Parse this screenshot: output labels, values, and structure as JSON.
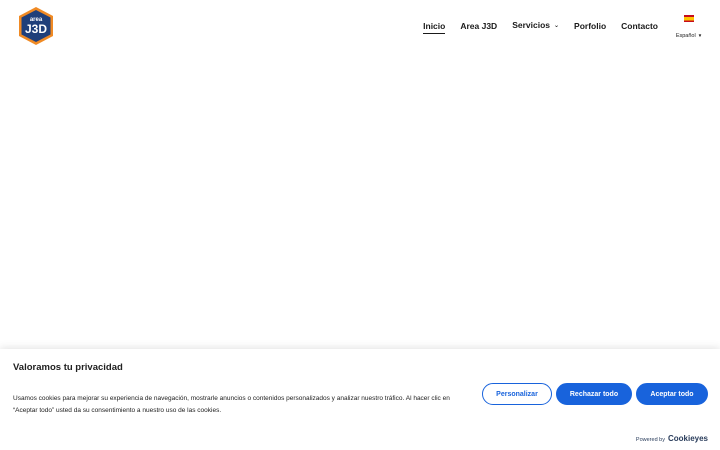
{
  "header": {
    "logo": {
      "line1": "area",
      "line2": "J3D",
      "icon": "area-j3d-logo"
    },
    "nav": [
      {
        "label": "Inicio",
        "active": true
      },
      {
        "label": "Area J3D"
      },
      {
        "label": "Servicios",
        "has_dropdown": true
      },
      {
        "label": "Porfolio"
      },
      {
        "label": "Contacto"
      }
    ],
    "language": {
      "label": "Español",
      "flag": "spain-flag-icon",
      "caret": "▼"
    }
  },
  "cookie_banner": {
    "title": "Valoramos tu privacidad",
    "description": "Usamos cookies para mejorar su experiencia de navegación, mostrarle anuncios o contenidos personalizados y analizar nuestro tráfico. Al hacer clic en “Aceptar todo” usted da su consentimiento a nuestro uso de las cookies.",
    "buttons": {
      "customize": "Personalizar",
      "reject": "Rechazar todo",
      "accept": "Aceptar todo"
    },
    "powered_by": "Powered by",
    "brand": "Cookieyes",
    "accent": "#1863dc"
  }
}
